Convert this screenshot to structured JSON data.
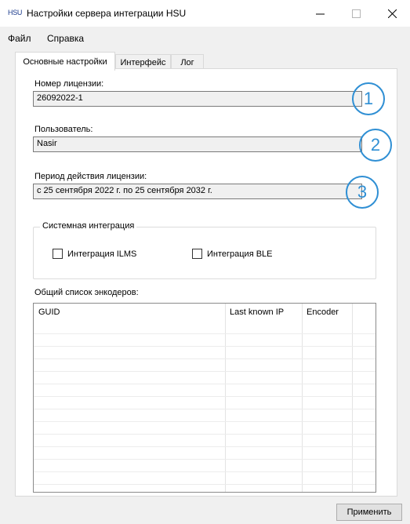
{
  "window": {
    "icon_text": "HSU",
    "title": "Настройки сервера интеграции HSU",
    "controls": {
      "minimize": "—",
      "maximize": "☐",
      "close": "✕"
    }
  },
  "menu": {
    "items": [
      "Файл",
      "Справка"
    ]
  },
  "tabs": [
    {
      "label": "Основные настройки",
      "active": true
    },
    {
      "label": "Интерфейс",
      "active": false
    },
    {
      "label": "Лог",
      "active": false
    }
  ],
  "license": {
    "label": "Номер лицензии:",
    "value": "26092022-1"
  },
  "user": {
    "label": "Пользователь:",
    "value": "Nasir"
  },
  "period": {
    "label": "Период действия лицензии:",
    "value": "с 25 сентября 2022 г. по 25 сентября 2032 г."
  },
  "annotations": [
    "1",
    "2",
    "3"
  ],
  "system_integration": {
    "title": "Системная интеграция",
    "options": [
      {
        "label": "Интеграция ILMS",
        "checked": false
      },
      {
        "label": "Интеграция BLE",
        "checked": false
      }
    ]
  },
  "encoders": {
    "label": "Общий список энкодеров:",
    "columns": [
      "GUID",
      "Last known IP",
      "Encoder"
    ]
  },
  "actions": {
    "apply": "Применить"
  },
  "colors": {
    "annotation": "#2f8fd4",
    "field_bg": "#f0f0f0",
    "window_bg": "#f0f0f0"
  }
}
